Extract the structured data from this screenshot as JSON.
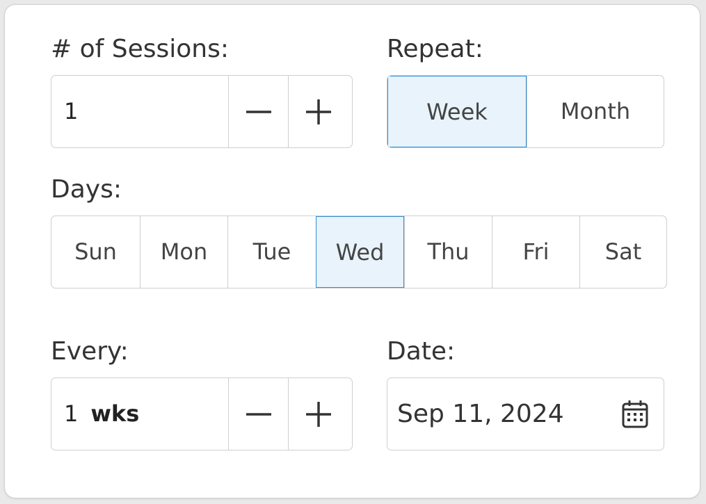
{
  "sessions": {
    "label": "# of Sessions:",
    "value": "1",
    "decrement_icon": "minus-icon",
    "increment_icon": "plus-icon"
  },
  "repeat": {
    "label": "Repeat:",
    "options": [
      "Week",
      "Month"
    ],
    "selected": "Week"
  },
  "days": {
    "label": "Days:",
    "options": [
      "Sun",
      "Mon",
      "Tue",
      "Wed",
      "Thu",
      "Fri",
      "Sat"
    ],
    "selected": "Wed"
  },
  "every": {
    "label": "Every:",
    "value": "1",
    "unit": "wks",
    "decrement_icon": "minus-icon",
    "increment_icon": "plus-icon"
  },
  "date": {
    "label": "Date:",
    "value": "Sep 11, 2024",
    "icon": "calendar-icon"
  },
  "colors": {
    "accent": "#2f8fd6",
    "selected_bg": "#e8f3fb",
    "border": "#cfcfcf"
  }
}
